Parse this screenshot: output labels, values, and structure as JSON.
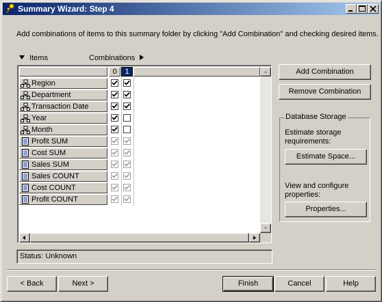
{
  "window": {
    "title": "Summary Wizard: Step 4",
    "controls": [
      "minimize",
      "maximize",
      "close"
    ]
  },
  "instructions": "Add combinations of items to this summary folder by clicking \"Add Combination\" and checking desired items.",
  "grid": {
    "items_header": "Items",
    "combinations_header": "Combinations",
    "columns": [
      "0",
      "1"
    ],
    "selected_column": "1",
    "rows": [
      {
        "label": "Region",
        "icon": "hierarchy-icon",
        "c0": true,
        "c1": true,
        "enabled": true
      },
      {
        "label": "Department",
        "icon": "hierarchy-icon",
        "c0": true,
        "c1": true,
        "enabled": true
      },
      {
        "label": "Transaction Date",
        "icon": "hierarchy-icon",
        "c0": true,
        "c1": true,
        "enabled": true
      },
      {
        "label": "Year",
        "icon": "hierarchy-icon",
        "c0": true,
        "c1": false,
        "enabled": true
      },
      {
        "label": "Month",
        "icon": "hierarchy-icon",
        "c0": true,
        "c1": false,
        "enabled": true
      },
      {
        "label": "Profit SUM",
        "icon": "measure-icon",
        "c0": true,
        "c1": true,
        "enabled": false
      },
      {
        "label": "Cost SUM",
        "icon": "measure-icon",
        "c0": true,
        "c1": true,
        "enabled": false
      },
      {
        "label": "Sales SUM",
        "icon": "measure-icon",
        "c0": true,
        "c1": true,
        "enabled": false
      },
      {
        "label": "Sales COUNT",
        "icon": "measure-icon",
        "c0": true,
        "c1": true,
        "enabled": false
      },
      {
        "label": "Cost COUNT",
        "icon": "measure-icon",
        "c0": true,
        "c1": true,
        "enabled": false
      },
      {
        "label": "Profit COUNT",
        "icon": "measure-icon",
        "c0": true,
        "c1": true,
        "enabled": false
      }
    ]
  },
  "buttons": {
    "add_combination": "Add Combination",
    "remove_combination": "Remove Combination",
    "estimate_space": "Estimate Space...",
    "properties": "Properties...",
    "back": "< Back",
    "next": "Next >",
    "finish": "Finish",
    "cancel": "Cancel",
    "help": "Help"
  },
  "database_storage": {
    "legend": "Database Storage",
    "estimate_text": "Estimate storage requirements:",
    "configure_text": "View and configure properties:"
  },
  "status": "Status: Unknown",
  "colors": {
    "title_start": "#0a246a",
    "title_end": "#a6caf0",
    "selected_column": "#0a246a",
    "face": "#d4d0c8"
  }
}
